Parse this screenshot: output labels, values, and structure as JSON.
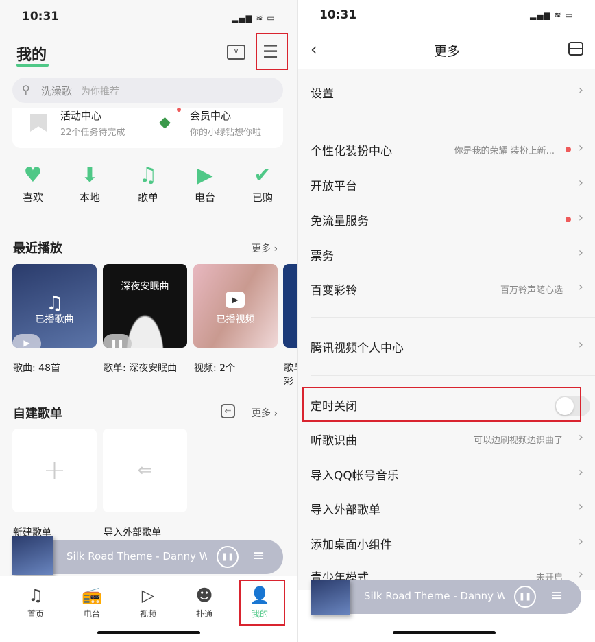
{
  "left": {
    "status": {
      "time": "10:31"
    },
    "title": "我的",
    "search": {
      "placeholder": "洗澡歌",
      "hint": "为你推荐"
    },
    "cards": [
      {
        "title": "活动中心",
        "sub": "22个任务待完成"
      },
      {
        "title": "会员中心",
        "sub": "你的小绿钻想你啦"
      }
    ],
    "shortcuts": [
      {
        "label": "喜欢",
        "icon": "heart-icon"
      },
      {
        "label": "本地",
        "icon": "download-icon"
      },
      {
        "label": "歌单",
        "icon": "music-note-icon"
      },
      {
        "label": "电台",
        "icon": "tv-icon"
      },
      {
        "label": "已购",
        "icon": "check-circle-icon"
      }
    ],
    "recent": {
      "title": "最近播放",
      "more": "更多",
      "tiles": [
        {
          "overlay": "已播歌曲",
          "caption": "歌曲: 48首"
        },
        {
          "overlay": "深夜安眠曲",
          "caption": "歌单: 深夜安眠曲"
        },
        {
          "overlay": "已播视频",
          "caption": "视频: 2个"
        },
        {
          "overlay": "",
          "caption": "歌单",
          "caption2": "彩"
        }
      ]
    },
    "playlists": {
      "title": "自建歌单",
      "more": "更多",
      "items": [
        {
          "label": "新建歌单"
        },
        {
          "label": "导入外部歌单"
        }
      ]
    },
    "player": {
      "song": "Silk Road Theme - Danny W"
    },
    "tabs": [
      {
        "label": "首页"
      },
      {
        "label": "电台"
      },
      {
        "label": "视频"
      },
      {
        "label": "扑通"
      },
      {
        "label": "我的"
      }
    ],
    "accent": "#4fc887"
  },
  "right": {
    "status": {
      "time": "10:31"
    },
    "title": "更多",
    "rows": [
      {
        "label": "设置"
      },
      {
        "label": "个性化装扮中心",
        "sub": "你是我的荣耀 装扮上新...",
        "dot": true
      },
      {
        "label": "开放平台"
      },
      {
        "label": "免流量服务",
        "dot": true
      },
      {
        "label": "票务"
      },
      {
        "label": "百变彩铃",
        "sub": "百万铃声随心选"
      },
      {
        "label": "腾讯视频个人中心"
      },
      {
        "label": "定时关闭",
        "toggle": false
      },
      {
        "label": "听歌识曲",
        "sub": "可以边刷视频边识曲了"
      },
      {
        "label": "导入QQ帐号音乐"
      },
      {
        "label": "导入外部歌单"
      },
      {
        "label": "添加桌面小组件"
      },
      {
        "label": "青少年模式",
        "sub": "未开启"
      }
    ],
    "player": {
      "song": "Silk Road Theme - Danny W"
    }
  }
}
